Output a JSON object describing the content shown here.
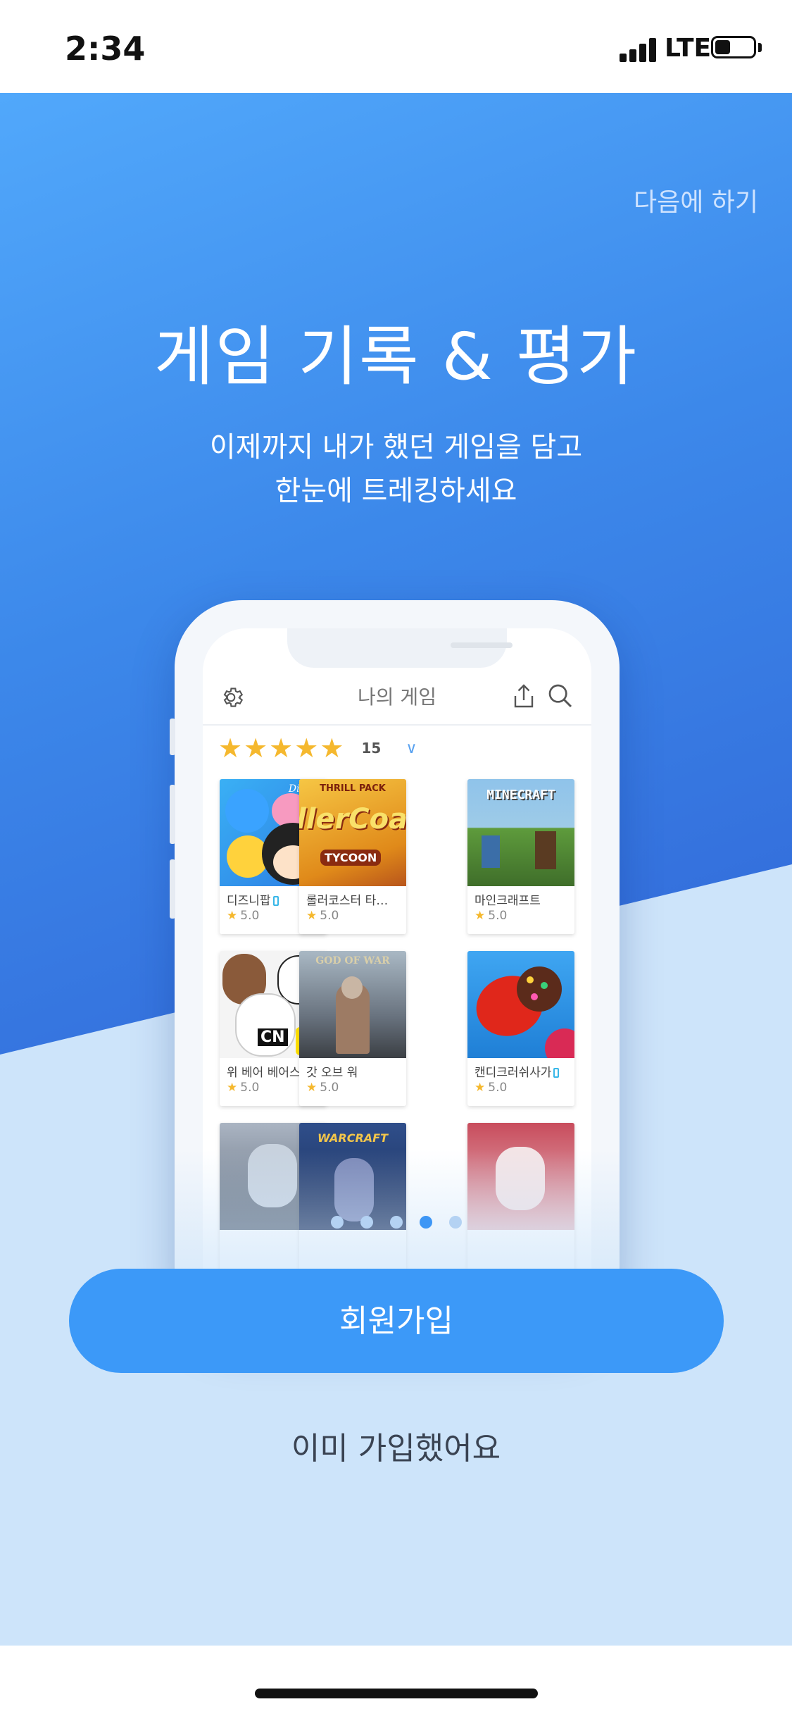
{
  "status_bar": {
    "time": "2:34",
    "network": "LTE",
    "battery_level": 0.4
  },
  "skip_label": "다음에 하기",
  "headline": "게임 기록 & 평가",
  "subtitle_line1": "이제까지 내가 했던 게임을 담고",
  "subtitle_line2": "한눈에 트레킹하세요",
  "mockup": {
    "title": "나의 게임",
    "rating_filter": {
      "stars": 5,
      "count": "15"
    },
    "games": [
      {
        "name": "디즈니팝",
        "rating": "5.0",
        "mobile": true
      },
      {
        "name": "롤러코스터 타…",
        "rating": "5.0",
        "mobile": false
      },
      {
        "name": "마인크래프트",
        "rating": "5.0",
        "mobile": false
      },
      {
        "name": "위 베어 베어스 …",
        "rating": "5.0",
        "mobile": false
      },
      {
        "name": "갓 오브 워",
        "rating": "5.0",
        "mobile": false
      },
      {
        "name": "캔디크러쉬사가",
        "rating": "5.0",
        "mobile": true
      }
    ],
    "art_text": {
      "disney": "Disney",
      "thrill": "THRILL PACK",
      "roller": "llerCoa",
      "tycoon": "TYCOON",
      "minecraft": "MINECRAFT",
      "cn": "CN",
      "gow": "GOD OF WAR",
      "warcraft": "WARCRAFT"
    }
  },
  "pagination": {
    "total": 5,
    "active_index": 3
  },
  "signup_label": "회원가입",
  "login_label": "이미 가입했어요",
  "colors": {
    "primary": "#3c99f8",
    "hero_blue": "#3c88ea",
    "hero_light": "#cde4fa"
  }
}
